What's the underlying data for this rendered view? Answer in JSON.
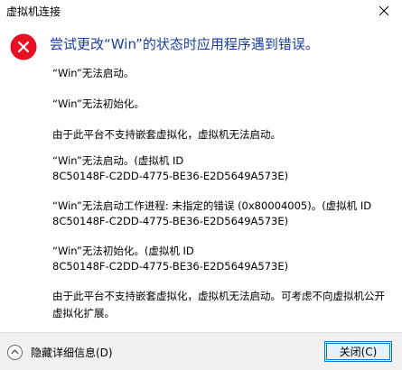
{
  "window": {
    "title": "虚拟机连接"
  },
  "dialog": {
    "heading": "尝试更改“Win”的状态时应用程序遇到错误。",
    "icon": "error-icon",
    "messages": [
      "“Win”无法启动。",
      "“Win”无法初始化。",
      "由于此平台不支持嵌套虚拟化，虚拟机无法启动。",
      "“Win”无法启动。(虚拟机 ID",
      "8C50148F-C2DD-4775-BE36-E2D5649A573E)",
      "“Win”无法启动工作进程: 未指定的错误 (0x80004005)。(虚拟机 ID",
      "8C50148F-C2DD-4775-BE36-E2D5649A573E)",
      "“Win”无法初始化。(虚拟机 ID",
      "8C50148F-C2DD-4775-BE36-E2D5649A573E)",
      "由于此平台不支持嵌套虚拟化，虚拟机无法启动。可考虑不向虚拟机公开",
      "虚拟化扩展。"
    ]
  },
  "footer": {
    "details_label": "隐藏详细信息(D)",
    "close_label": "关闭(C)"
  },
  "colors": {
    "heading": "#1a3f9e",
    "error_icon": "#e81123",
    "button_border": "#0078d7"
  }
}
